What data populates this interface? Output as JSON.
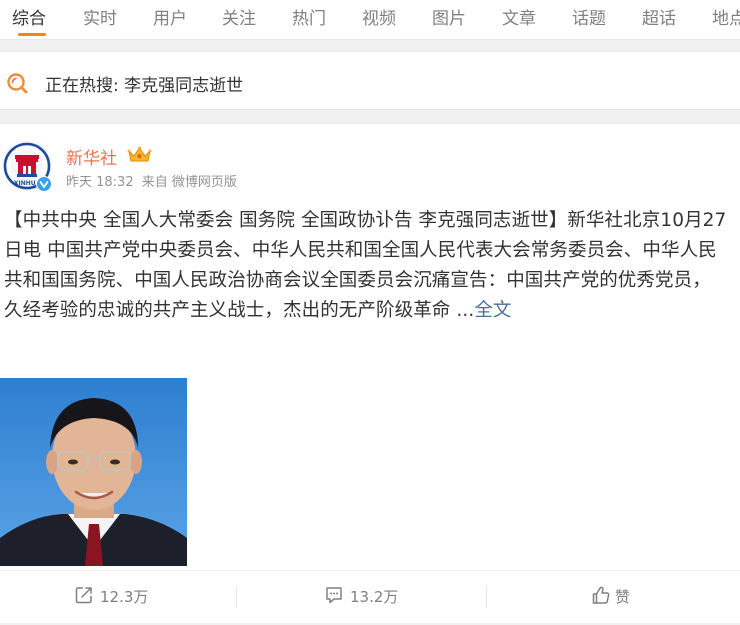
{
  "tabs": [
    {
      "label": "综合",
      "active": true
    },
    {
      "label": "实时"
    },
    {
      "label": "用户"
    },
    {
      "label": "关注"
    },
    {
      "label": "热门"
    },
    {
      "label": "视频"
    },
    {
      "label": "图片"
    },
    {
      "label": "文章"
    },
    {
      "label": "话题"
    },
    {
      "label": "超话"
    },
    {
      "label": "地点"
    }
  ],
  "hot_search": {
    "text": "正在热搜: 李克强同志逝世",
    "icon": "search-icon"
  },
  "post": {
    "author": "新华社",
    "author_badge_icon": "crown-icon",
    "verified_icon": "verified-v-icon",
    "time": "昨天 18:32",
    "source": "来自 微博网页版",
    "text": "【中共中央 全国人大常委会 国务院 全国政协讣告 李克强同志逝世】新华社北京10月27日电 中国共产党中央委员会、中华人民共和国全国人民代表大会常务委员会、中华人民共和国国务院、中国人民政治协商会议全国委员会沉痛宣告：中国共产党的优秀党员，久经考验的忠诚的共产主义战士，杰出的无产阶级革命 ...",
    "more_link": "全文",
    "actions": {
      "repost": {
        "count": "12.3万",
        "icon": "repost-icon"
      },
      "comment": {
        "count": "13.2万",
        "icon": "comment-icon"
      },
      "like": {
        "label": "赞",
        "icon": "thumbs-up-icon"
      }
    }
  },
  "colors": {
    "accent": "#ff8200",
    "author_name": "#eb7350",
    "link": "#4a6e9c",
    "text_primary": "#333333",
    "text_muted": "#939393"
  }
}
